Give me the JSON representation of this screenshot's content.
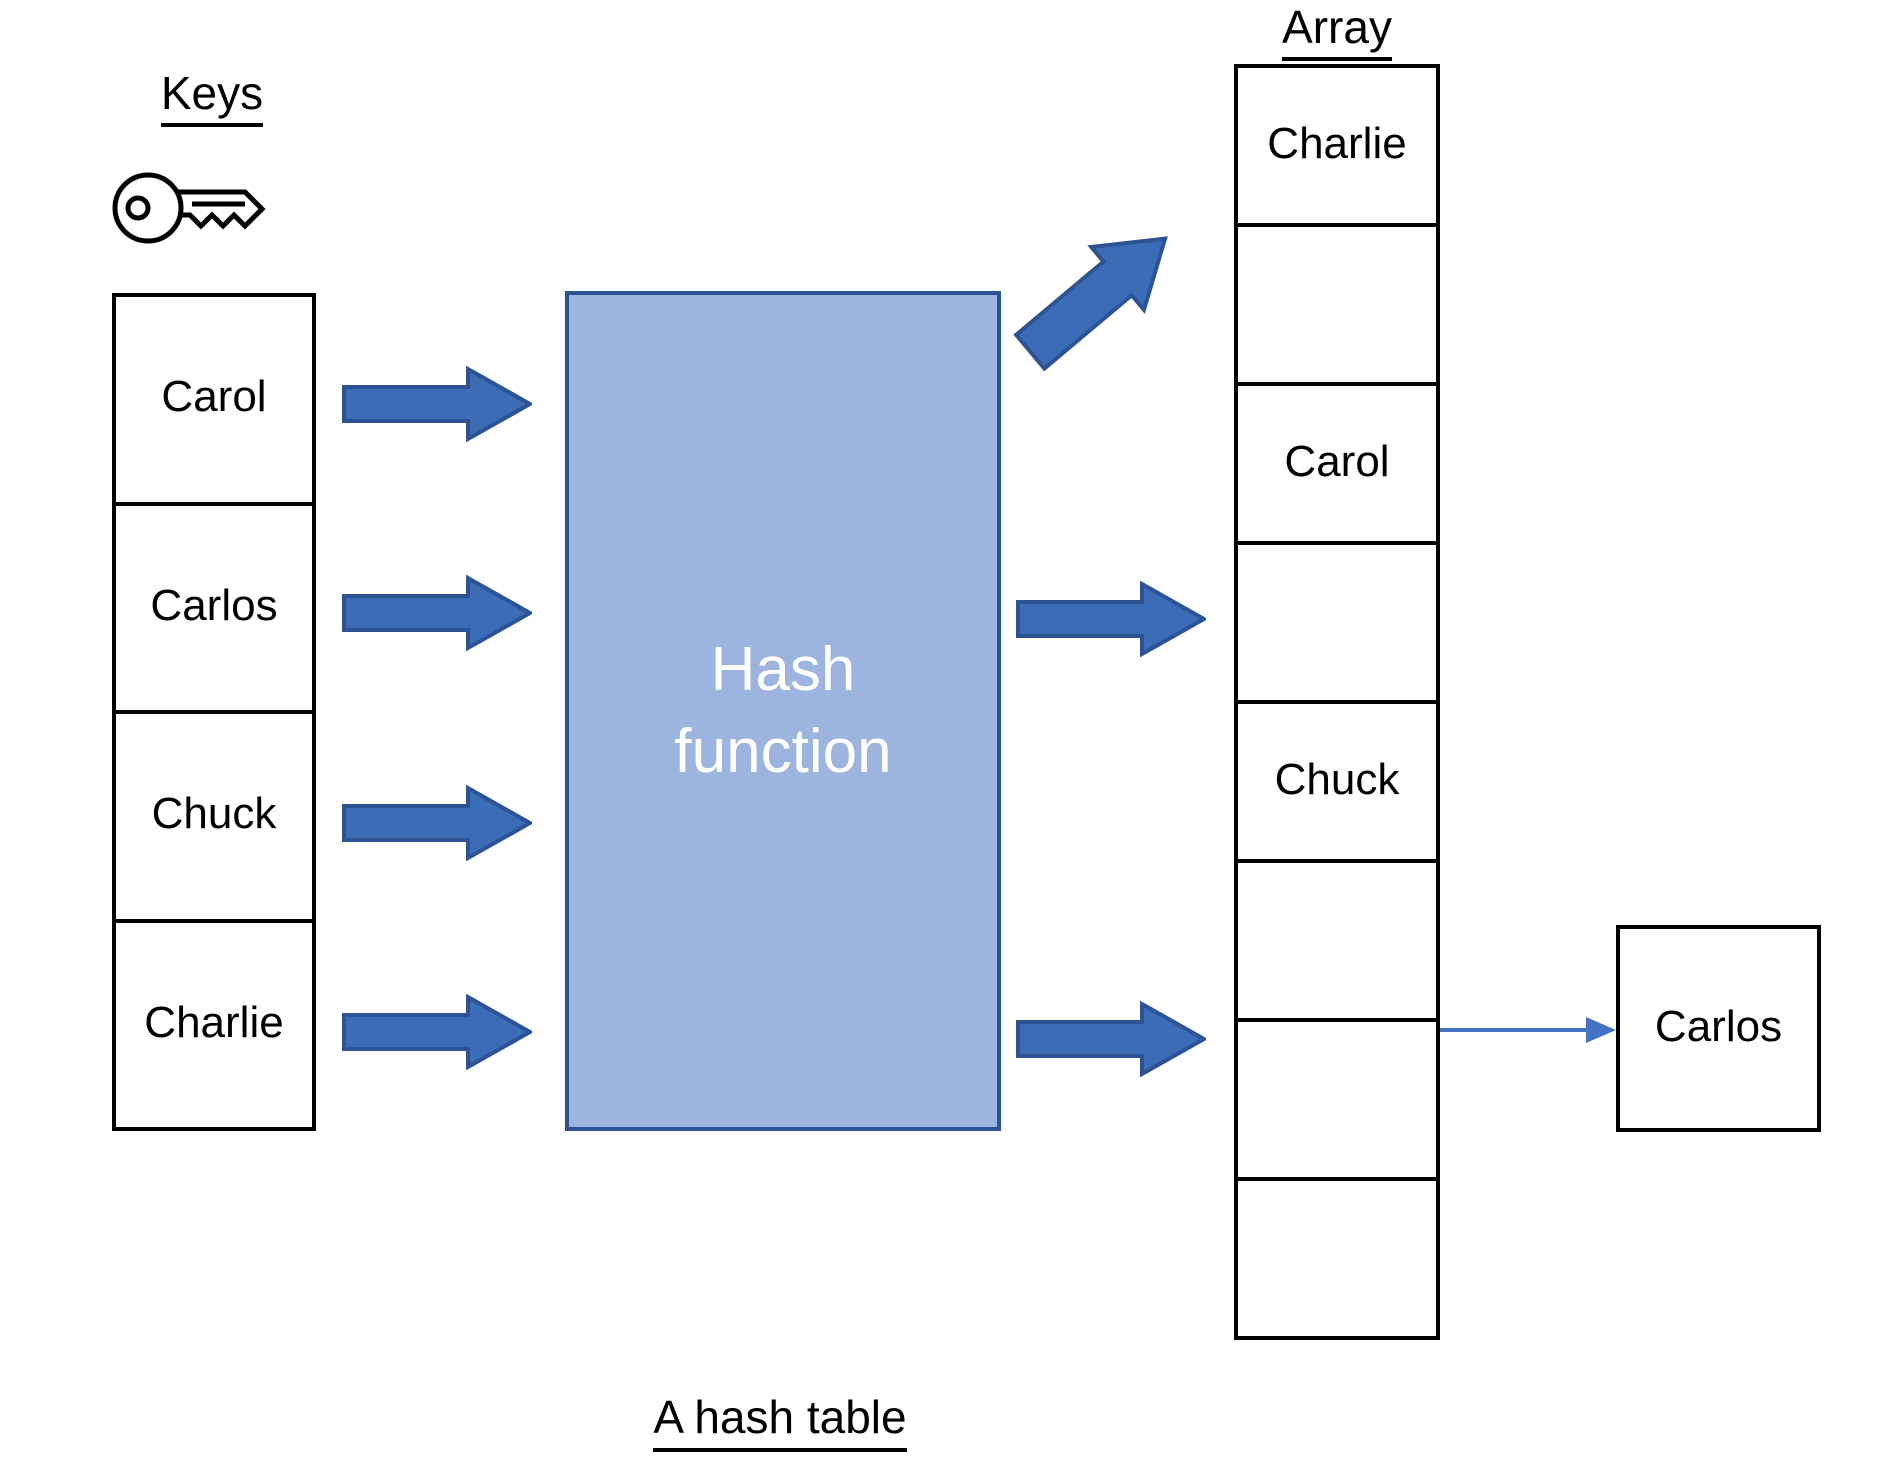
{
  "diagram": {
    "caption": "A hash table",
    "keys": {
      "heading": "Keys",
      "icon": "key-icon",
      "items": [
        "Carol",
        "Carlos",
        "Chuck",
        "Charlie"
      ]
    },
    "hash_function": {
      "label": "Hash\nfunction",
      "fill": "#9cb4de",
      "border": "#2d5395",
      "text_color": "#ffffff"
    },
    "array": {
      "heading": "Array",
      "slot_count": 8,
      "slots": [
        "Charlie",
        "",
        "Carol",
        "",
        "Chuck",
        "",
        "",
        ""
      ]
    },
    "overflow_node": {
      "label": "Carlos"
    },
    "arrows": {
      "color": "#3b6cb5",
      "border": "#2d5395",
      "thin_color": "#4472c4",
      "input_arrows": [
        {
          "from": "Carol",
          "to": "hash-function"
        },
        {
          "from": "Carlos",
          "to": "hash-function"
        },
        {
          "from": "Chuck",
          "to": "hash-function"
        },
        {
          "from": "Charlie",
          "to": "hash-function"
        }
      ],
      "output_arrows": [
        {
          "from": "hash-function",
          "to": "array-slot-0",
          "direction": "up-right"
        },
        {
          "from": "hash-function",
          "to": "array-slot-2",
          "direction": "right"
        },
        {
          "from": "hash-function",
          "to": "array-slot-4",
          "direction": "right"
        }
      ],
      "chain_arrow": {
        "from": "array-slot-4",
        "to": "overflow-node"
      }
    }
  }
}
